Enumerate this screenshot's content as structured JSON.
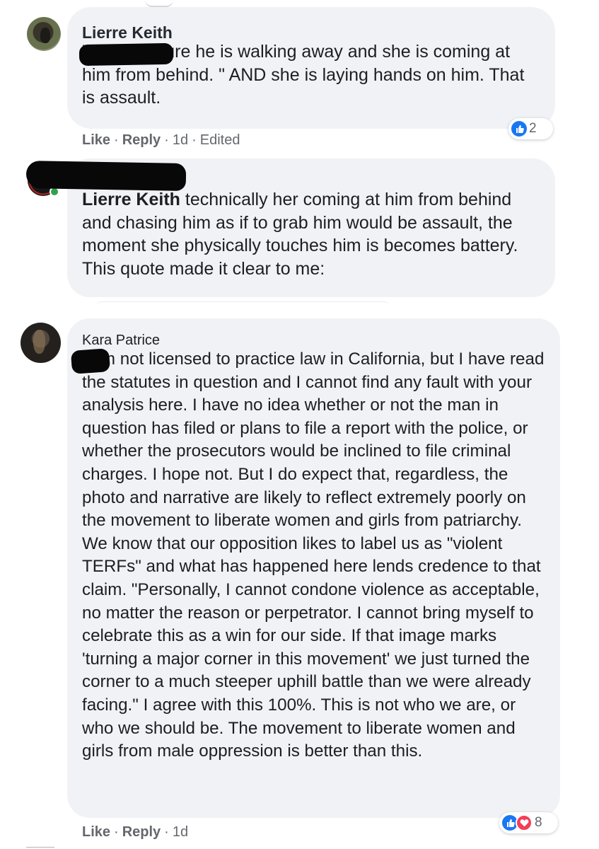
{
  "comments": [
    {
      "author": "Lierre Keith",
      "text": "\"In the picture he is walking away and she is coming at him from behind. \" AND she is laying hands on him. That is assault.",
      "actions": {
        "like": "Like",
        "reply": "Reply",
        "time": "1d",
        "edited": "Edited"
      },
      "reactions": {
        "icons": [
          "like-icon"
        ],
        "count": "2"
      }
    },
    {
      "mention": "Lierre Keith",
      "text": " technically her coming at him from behind and chasing him as if to grab him would be assault, the moment she physically touches him is becomes battery. This quote made it clear to me:"
    },
    {
      "author": "Kara Patrice",
      "text": "I am not licensed to practice law in California, but I have read the statutes in question and I cannot find any fault with your analysis here. I have no idea whether or not the man in question has filed or plans to file a report with the police, or whether the prosecutors would be inclined to file criminal charges. I hope not. But I do expect that, regardless, the photo and narrative are likely to reflect extremely poorly on the movement to liberate women and girls from patriarchy. We know that our opposition likes to label us as \"violent TERFs\" and what has happened here lends credence to that claim. \"Personally, I cannot condone violence as acceptable, no matter the reason or perpetrator. I cannot bring myself to celebrate this as a win for our side. If that image marks 'turning a major corner in this movement' we just turned the corner to a much steeper uphill battle than we were already facing.\" I agree with this 100%. This is not who we are, or who we should be. The movement to liberate women and girls from male oppression is better than this.",
      "actions": {
        "like": "Like",
        "reply": "Reply",
        "time": "1d"
      },
      "reactions": {
        "icons": [
          "like-icon",
          "heart-icon"
        ],
        "count": "8"
      }
    }
  ],
  "separator": "·",
  "colors": {
    "bubble": "#f0f2f5",
    "secondary_text": "#65676b",
    "like_blue": "#1877f2",
    "heart_red": "#f33e58"
  }
}
